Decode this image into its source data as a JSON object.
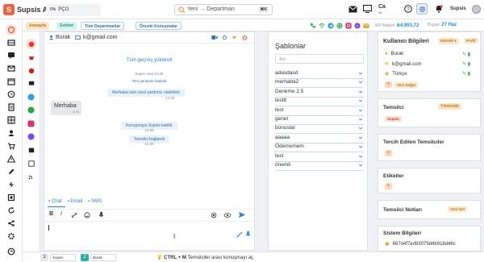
{
  "app": {
    "name": "Supsis Ai",
    "workspace_badge": "0%",
    "workspace": "PÇO"
  },
  "search": {
    "placeholder": "Yeni → Departman",
    "shortcut": "⌘K"
  },
  "topbar": {
    "counter": "26",
    "counter_label": "Ca",
    "user": "Supsis"
  },
  "subbar": {
    "tags": [
      "Arasayfa",
      "Sohbet",
      "Tüm Departmanlar",
      "Önceki Konuşmalar"
    ],
    "wp_label": "WP Bakiye:",
    "wp_value": "₺4.993,72",
    "today_label": "Bugün:",
    "today_value": "27 Haz"
  },
  "chat": {
    "contact_name": "Burak",
    "contact_email": "k@gmail.com",
    "history_loaded": "Tüm geçmiş yüklendi",
    "today_time": "bugün saat 14.39",
    "session_start": "Yeni görüşme başladı",
    "help_msg": "Merhaba size nasıl yardımcı olabilirim",
    "help_time": "14:39",
    "incoming_msg": "Merhaba",
    "incoming_time": "14:39",
    "joined_msg": "Konuşmaya Supsis katıldı",
    "joined_time": "14:39",
    "rep_msg": "Temsilci bağlandı",
    "rep_time": "14:39",
    "tabs": [
      "Chat",
      "Email",
      "SMS"
    ],
    "hint": "CTRL + M",
    "hint_text": "Temsilciler arası konuşmayı aç"
  },
  "templates": {
    "title": "Şablonlar",
    "search_placeholder": "Ara",
    "items": [
      "adasdasd",
      "merhaba2",
      "Deneme 2.5",
      "testtt",
      "test",
      "genel",
      "bonuslar",
      "aaaaa",
      "Ödememem",
      "test",
      "önemli"
    ]
  },
  "right_panel": {
    "user_info_title": "Kullanıcı Bilgileri",
    "badge_active": "Etkinlik ▾",
    "badge_profile": "Profil",
    "name": "Burak",
    "email": "k@gmail.com",
    "language": "Türkçe",
    "new_field": "Yeni Değer",
    "rep_title": "Temsilci",
    "rep_button": "Yönlendir",
    "rep_name": "Supsis",
    "tags_title": "Tercih Edilen Temsilciler",
    "labels_title": "Etiketler",
    "notes_title": "Temsilci Notları",
    "notes_button": "Yeni Not",
    "system_title": "Sistem Bilgileri",
    "system_id": "667d4f7ed93079d4b918d46c"
  },
  "bottom": {
    "tab1_num": "1",
    "tab1_name": "Supsis",
    "tab2_num": "2",
    "tab2_name": "Burak"
  },
  "colors": {
    "accent": "#f0623f",
    "primary": "#2b7de0",
    "teal": "#27b0a4",
    "orange": "#f2994a"
  }
}
